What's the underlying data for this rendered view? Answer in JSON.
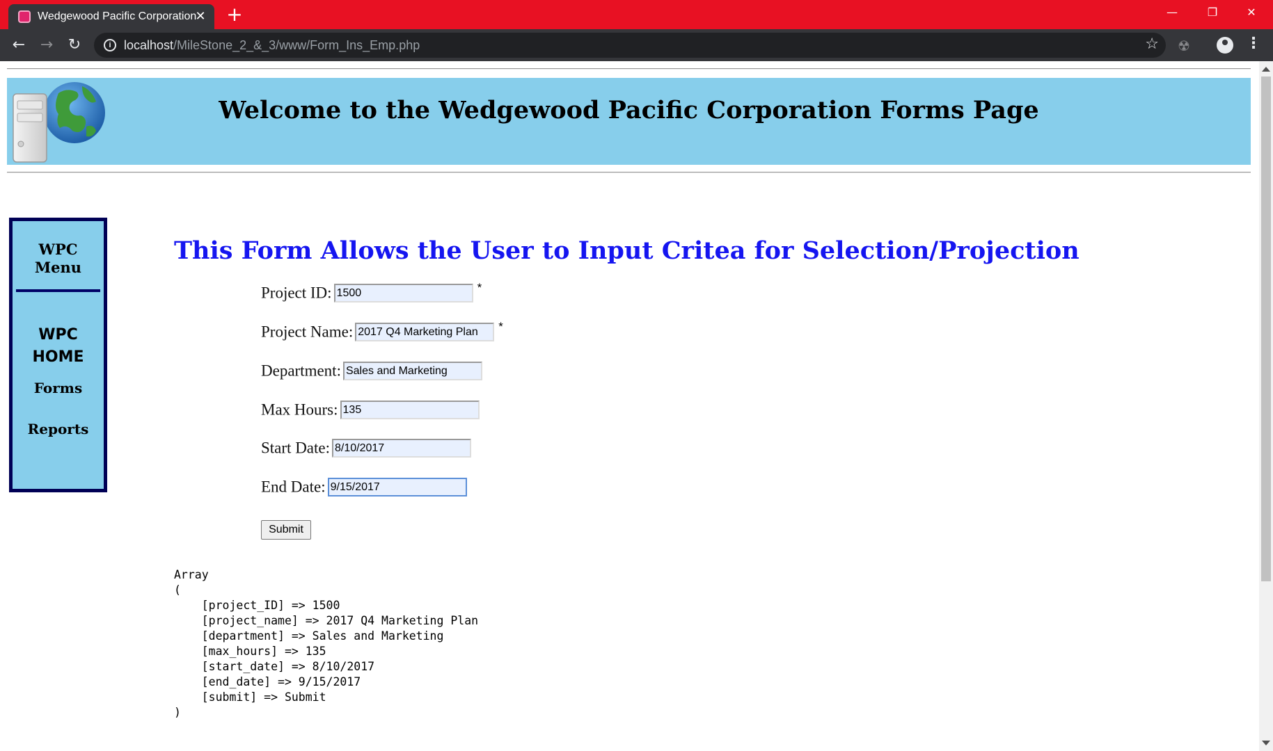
{
  "browser": {
    "tab_title": "Wedgewood Pacific Corporation",
    "tab_close": "✕",
    "new_tab": "+",
    "url_host": "localhost",
    "url_path": "/MileStone_2_&_3/www/Form_Ins_Emp.php",
    "window_controls": {
      "minimize": "—",
      "restore": "❐",
      "close": "✕"
    },
    "accent_color": "#e81123"
  },
  "banner": {
    "title": "Welcome to the Wedgewood Pacific Corporation Forms Page",
    "background": "#87ceeb"
  },
  "sidebar": {
    "menu_title_line1": "WPC",
    "menu_title_line2": "Menu",
    "home_line1": "WPC",
    "home_line2": "HOME",
    "forms": "Forms",
    "reports": "Reports"
  },
  "form": {
    "heading": "This Form Allows the User to Input Critea for Selection/Projection",
    "fields": [
      {
        "label": "Project ID:",
        "value": "1500",
        "required": "*"
      },
      {
        "label": "Project Name:",
        "value": "2017 Q4 Marketing Plan",
        "required": "*"
      },
      {
        "label": "Department:",
        "value": "Sales and Marketing"
      },
      {
        "label": "Max Hours:",
        "value": "135"
      },
      {
        "label": "Start Date:",
        "value": "8/10/2017"
      },
      {
        "label": "End Date:",
        "value": "9/15/2017"
      }
    ],
    "submit_label": "Submit"
  },
  "output": {
    "lines": [
      "Array",
      "(",
      "    [project_ID] => 1500",
      "    [project_name] => 2017 Q4 Marketing Plan",
      "    [department] => Sales and Marketing",
      "    [max_hours] => 135",
      "    [start_date] => 8/10/2017",
      "    [end_date] => 9/15/2017",
      "    [submit] => Submit",
      ")"
    ]
  }
}
